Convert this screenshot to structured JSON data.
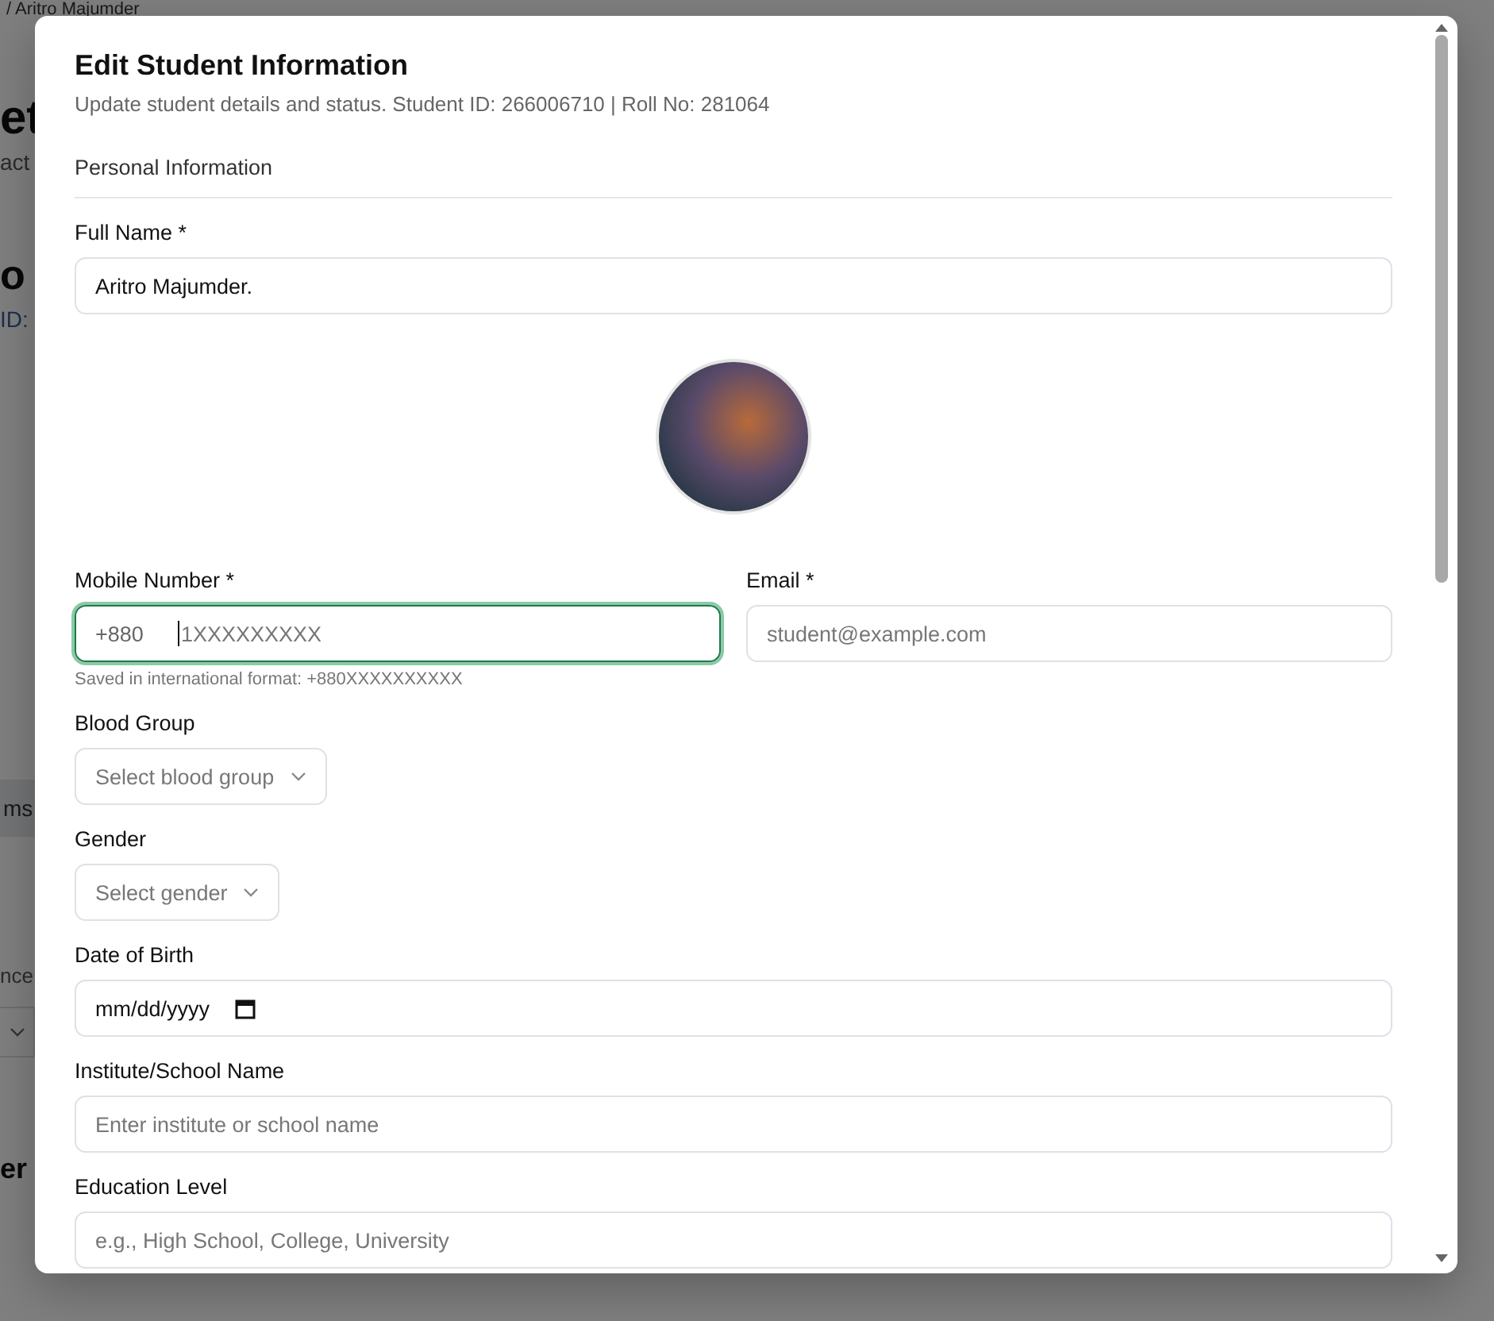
{
  "background_page": {
    "fragments": [
      {
        "kind": "crumb",
        "text": "/ Aritro Majumder"
      },
      {
        "kind": "heading",
        "text": "et"
      },
      {
        "kind": "muted",
        "text": "act"
      },
      {
        "kind": "name",
        "text": "o"
      },
      {
        "kind": "id",
        "text": "ID:"
      },
      {
        "kind": "chip",
        "text": "ms"
      },
      {
        "kind": "muted2",
        "text": "nce"
      },
      {
        "kind": "select"
      },
      {
        "kind": "section",
        "text": "er"
      }
    ]
  },
  "dialog": {
    "title": "Edit Student Information",
    "description": "Update student details and status. Student ID: 266006710 | Roll No: 281064",
    "section": "Personal Information",
    "fields": [
      {
        "kind": "text",
        "label": "Full Name *",
        "value": "Aritro Majumder."
      },
      {
        "kind": "avatar"
      },
      {
        "kind": "pair",
        "fields": [
          {
            "kind": "phone",
            "label": "Mobile Number *",
            "prefix": "+880",
            "placeholder": "1XXXXXXXXX",
            "focused": true,
            "hint": "Saved in international format: +880XXXXXXXXXX"
          },
          {
            "kind": "text",
            "label": "Email *",
            "placeholder": "student@example.com"
          }
        ]
      },
      {
        "kind": "select",
        "label": "Blood Group",
        "placeholder": "Select blood group"
      },
      {
        "kind": "select",
        "label": "Gender",
        "placeholder": "Select gender"
      },
      {
        "kind": "date",
        "label": "Date of Birth",
        "placeholder": "mm/dd/yyyy"
      },
      {
        "kind": "text",
        "label": "Institute/School Name",
        "placeholder": "Enter institute or school name"
      },
      {
        "kind": "text",
        "label": "Education Level",
        "placeholder": "e.g., High School, College, University"
      }
    ]
  }
}
